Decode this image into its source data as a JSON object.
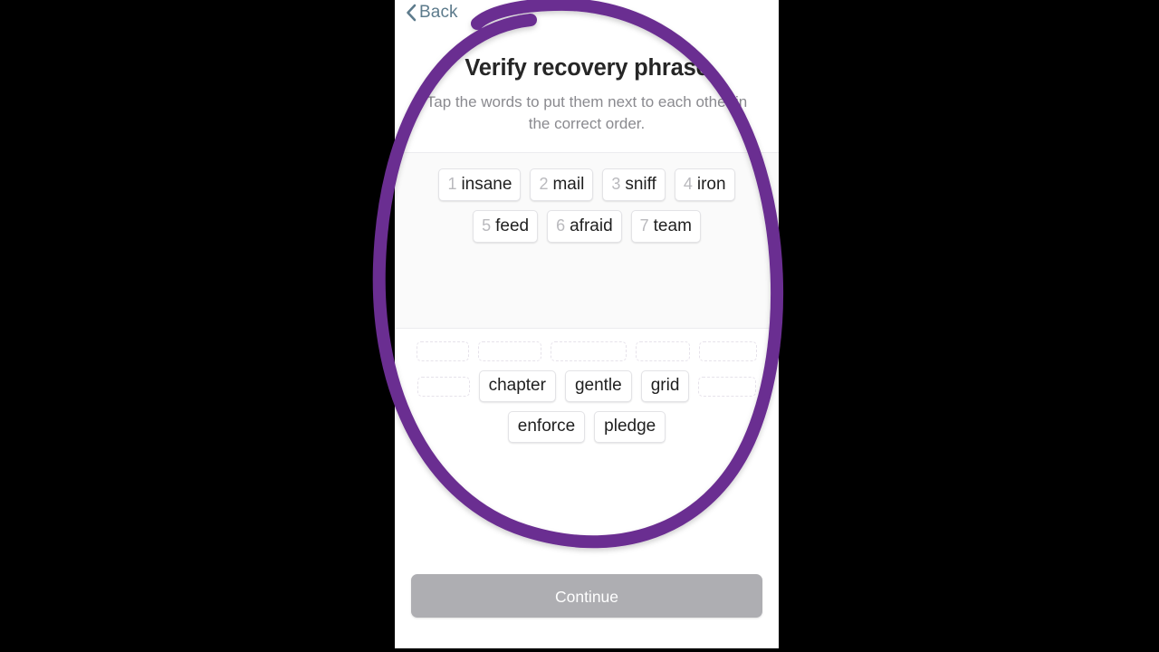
{
  "screen": {
    "app_kind": "mobile-wallet-recovery-phrase-verification"
  },
  "navbar": {
    "back_label": "Back",
    "back_icon": "chevron-left-icon",
    "back_color": "#5d7b8c"
  },
  "header": {
    "title": "Verify recovery phrase",
    "subtitle": "Tap the words to put them next to each other in the correct order."
  },
  "ordered_words": {
    "rows": [
      [
        {
          "index": "1",
          "word": "insane"
        },
        {
          "index": "2",
          "word": "mail"
        },
        {
          "index": "3",
          "word": "sniff"
        },
        {
          "index": "4",
          "word": "iron"
        }
      ],
      [
        {
          "index": "5",
          "word": "feed"
        },
        {
          "index": "6",
          "word": "afraid"
        },
        {
          "index": "7",
          "word": "team"
        }
      ]
    ]
  },
  "word_bank": {
    "rows": [
      {
        "items": [
          {
            "kind": "slot",
            "width": 56
          },
          {
            "kind": "slot",
            "width": 68
          },
          {
            "kind": "slot",
            "width": 82
          },
          {
            "kind": "slot",
            "width": 58
          },
          {
            "kind": "slot",
            "width": 62
          }
        ]
      },
      {
        "items": [
          {
            "kind": "slot",
            "width": 56
          },
          {
            "kind": "word",
            "word": "chapter"
          },
          {
            "kind": "word",
            "word": "gentle"
          },
          {
            "kind": "word",
            "word": "grid"
          },
          {
            "kind": "slot",
            "width": 62
          }
        ]
      },
      {
        "items": [
          {
            "kind": "word",
            "word": "enforce"
          },
          {
            "kind": "word",
            "word": "pledge"
          }
        ]
      }
    ]
  },
  "footer": {
    "continue_label": "Continue",
    "continue_enabled": false,
    "continue_color": "#aeaeb2"
  },
  "annotation": {
    "kind": "hand-drawn-ellipse-highlight",
    "color": "#6b2d91",
    "stroke_width": 14
  }
}
